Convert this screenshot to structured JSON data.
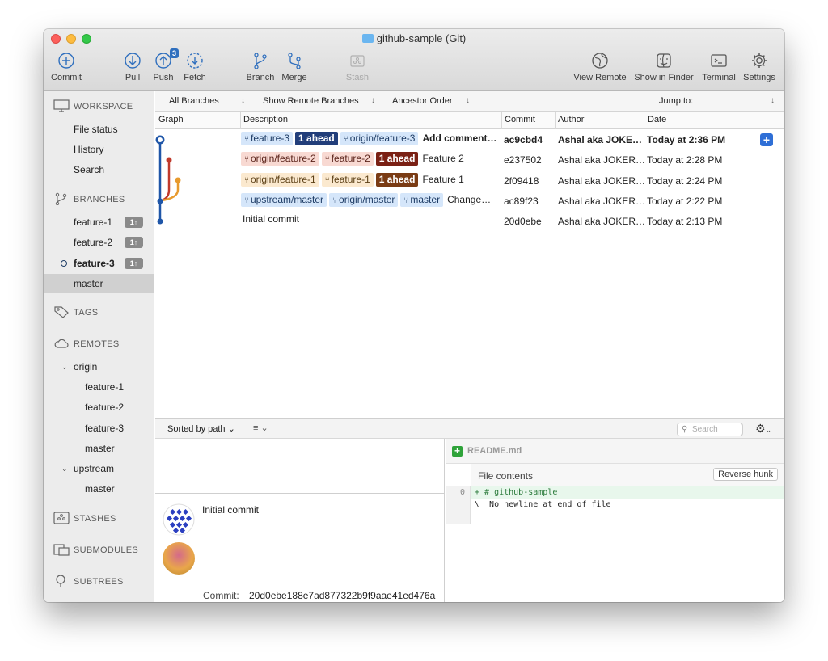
{
  "window": {
    "title": "github-sample (Git)"
  },
  "toolbar": {
    "commit": "Commit",
    "pull": "Pull",
    "push": "Push",
    "push_badge": "3",
    "fetch": "Fetch",
    "branch": "Branch",
    "merge": "Merge",
    "stash": "Stash",
    "view_remote": "View Remote",
    "show_in_finder": "Show in Finder",
    "terminal": "Terminal",
    "settings": "Settings"
  },
  "sidebar": {
    "workspace": "WORKSPACE",
    "workspace_items": [
      "File status",
      "History",
      "Search"
    ],
    "branches": "BRANCHES",
    "branch_items": [
      {
        "label": "feature-1",
        "ahead": "1↑"
      },
      {
        "label": "feature-2",
        "ahead": "1↑"
      },
      {
        "label": "feature-3",
        "ahead": "1↑"
      },
      {
        "label": "master"
      }
    ],
    "tags": "TAGS",
    "remotes": "REMOTES",
    "origin": "origin",
    "origin_items": [
      "feature-1",
      "feature-2",
      "feature-3",
      "master"
    ],
    "upstream": "upstream",
    "upstream_items": [
      "master"
    ],
    "stashes": "STASHES",
    "submodules": "SUBMODULES",
    "subtrees": "SUBTREES"
  },
  "filters": {
    "branches": "All Branches",
    "remote": "Show Remote Branches",
    "order": "Ancestor Order",
    "jump": "Jump to:"
  },
  "columns": {
    "graph": "Graph",
    "description": "Description",
    "commit": "Commit",
    "author": "Author",
    "date": "Date"
  },
  "commits": [
    {
      "tags": [
        {
          "text": "feature-3",
          "style": "blue",
          "icon": true
        },
        {
          "text": "1 ahead",
          "style": "ahead-blue"
        },
        {
          "text": "origin/feature-3",
          "style": "blue",
          "icon": true
        }
      ],
      "message": "Add comment…",
      "hash": "ac9cbd4",
      "author": "Ashal aka JOKE…",
      "date": "Today at 2:36 PM",
      "bold": true
    },
    {
      "tags": [
        {
          "text": "origin/feature-2",
          "style": "red",
          "icon": true
        },
        {
          "text": "feature-2",
          "style": "red",
          "icon": true
        },
        {
          "text": "1 ahead",
          "style": "ahead-red"
        }
      ],
      "message": "Feature 2",
      "hash": "e237502",
      "author": "Ashal aka JOKER…",
      "date": "Today at 2:28 PM"
    },
    {
      "tags": [
        {
          "text": "origin/feature-1",
          "style": "orange",
          "icon": true
        },
        {
          "text": "feature-1",
          "style": "orange",
          "icon": true
        },
        {
          "text": "1 ahead",
          "style": "ahead-orange"
        }
      ],
      "message": "Feature 1",
      "hash": "2f09418",
      "author": "Ashal aka JOKER…",
      "date": "Today at 2:24 PM"
    },
    {
      "tags": [
        {
          "text": "upstream/master",
          "style": "blue",
          "icon": true
        },
        {
          "text": "origin/master",
          "style": "blue",
          "icon": true
        },
        {
          "text": "master",
          "style": "blue",
          "icon": true
        }
      ],
      "message": "Change…",
      "hash": "ac89f23",
      "author": "Ashal aka JOKER…",
      "date": "Today at 2:22 PM"
    },
    {
      "tags": [],
      "message": "Initial commit",
      "hash": "20d0ebe",
      "author": "Ashal aka JOKER…",
      "date": "Today at 2:13 PM"
    }
  ],
  "bottom": {
    "sorted": "Sorted by path",
    "search_placeholder": "Search"
  },
  "details": {
    "message": "Initial commit",
    "commit_label": "Commit:",
    "commit_hash": "20d0ebe188e7ad877322b9f9aae41ed476a"
  },
  "diff": {
    "filename": "README.md",
    "hunk_title": "File contents",
    "reverse_hunk": "Reverse hunk",
    "line_number": "0",
    "lines": [
      "+ # github-sample",
      "\\  No newline at end of file"
    ]
  },
  "colors": {
    "accent": "#2f6fd6",
    "graph_blue": "#1f56a8",
    "graph_red": "#c0392b",
    "graph_orange": "#e89a2e"
  }
}
